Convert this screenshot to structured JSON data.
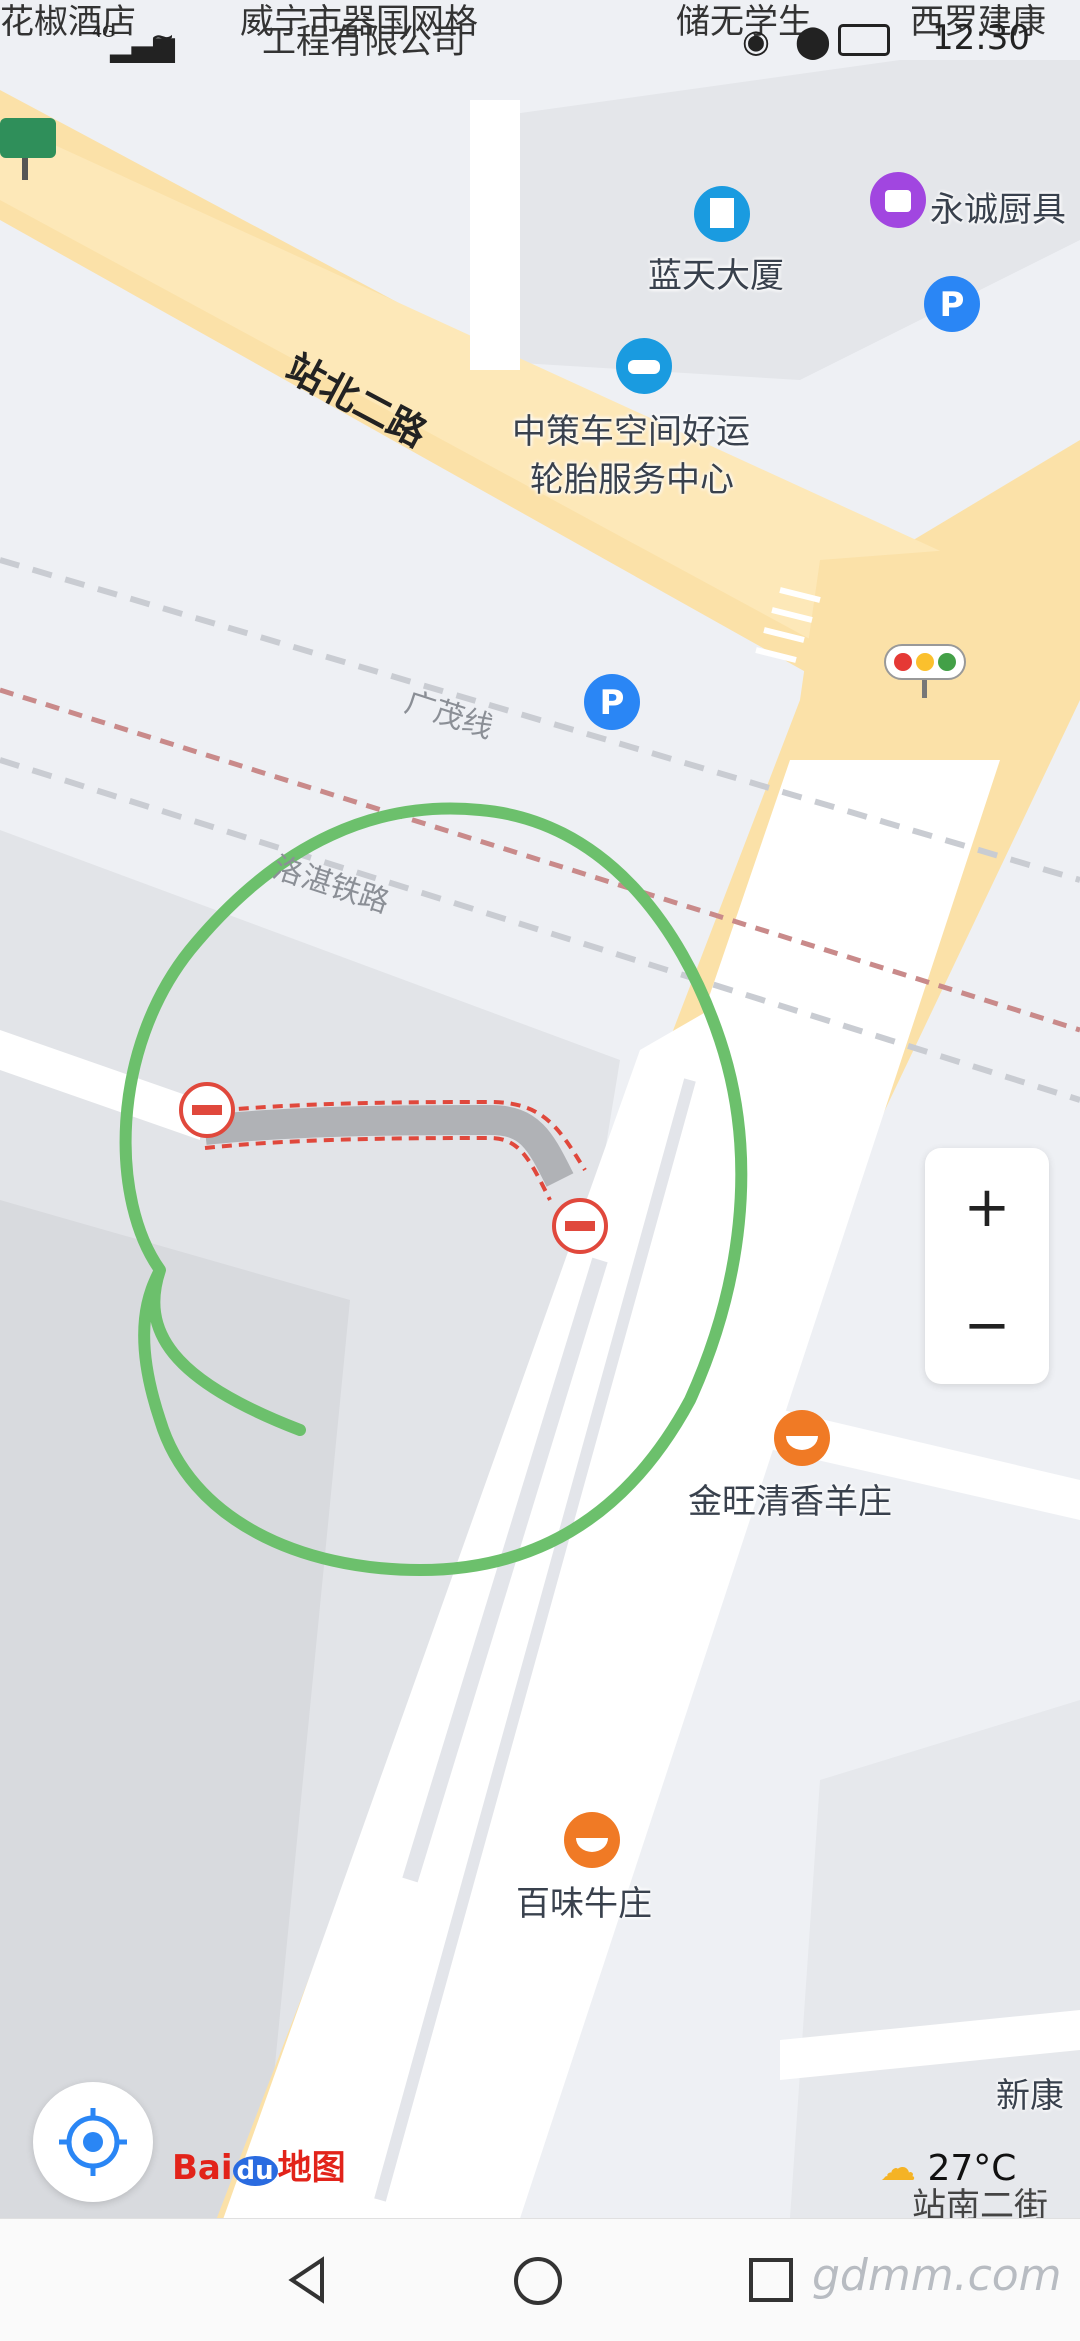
{
  "status_bar": {
    "network": "4G",
    "time": "12:30",
    "top_fragments": [
      "花椒酒店",
      "威宁市器国网格",
      "工程有限公司",
      "储无学生",
      "西罗建康"
    ]
  },
  "map": {
    "roads": [
      {
        "name": "站北二路"
      },
      {
        "name": "站南二街"
      }
    ],
    "railways": [
      "广茂线",
      "洛湛铁路"
    ],
    "pois": [
      {
        "name": "蓝天大厦",
        "icon": "building-icon",
        "color": "#1a9be0"
      },
      {
        "name": "永诚厨具",
        "icon": "shopping-bag-icon",
        "color": "#a146e0"
      },
      {
        "name": "中策车空间好运",
        "line2": "轮胎服务中心",
        "icon": "car-icon",
        "color": "#1a9be0"
      },
      {
        "name": "金旺清香羊庄",
        "icon": "food-bowl-icon",
        "color": "#f07a25"
      },
      {
        "name": "百味牛庄",
        "icon": "food-bowl-icon",
        "color": "#f07a25"
      },
      {
        "name": "新康",
        "icon": "",
        "color": ""
      }
    ],
    "parking_label": "P",
    "accent_color": "#2a86f5",
    "closure_color": "#e0483c",
    "annotation_color": "#6cc06c"
  },
  "zoom": {
    "in_label": "+",
    "out_label": "−"
  },
  "logo": {
    "text_bai": "Bai",
    "text_du": "du",
    "text_map": "地图"
  },
  "weather": {
    "temperature": "27°C",
    "icon": "cloud-sun-icon"
  },
  "watermark": "gdmm.com",
  "nav": {
    "back": "back-icon",
    "home": "home-icon",
    "recents": "recents-icon"
  }
}
